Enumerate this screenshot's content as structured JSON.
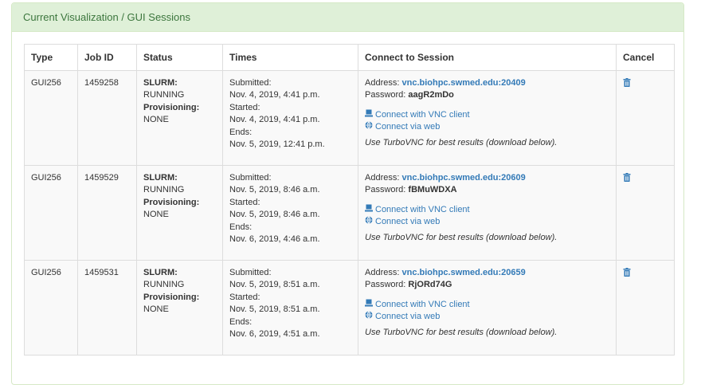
{
  "panel": {
    "title": "Current Visualization / GUI Sessions"
  },
  "table": {
    "headers": {
      "type": "Type",
      "job_id": "Job ID",
      "status": "Status",
      "times": "Times",
      "connect": "Connect to Session",
      "cancel": "Cancel"
    },
    "labels": {
      "slurm": "SLURM:",
      "provisioning": "Provisioning:",
      "submitted": "Submitted:",
      "started": "Started:",
      "ends": "Ends:",
      "address": "Address:",
      "password": "Password:",
      "connect_vnc": "Connect with VNC client",
      "connect_web": "Connect via web",
      "hint": "Use TurboVNC for best results (download below)."
    },
    "rows": [
      {
        "type": "GUI256",
        "job_id": "1459258",
        "slurm_status": "RUNNING",
        "provisioning_status": "NONE",
        "submitted": "Nov. 4, 2019, 4:41 p.m.",
        "started": "Nov. 4, 2019, 4:41 p.m.",
        "ends": "Nov. 5, 2019, 12:41 p.m.",
        "address": "vnc.biohpc.swmed.edu:20409",
        "password": "aagR2mDo"
      },
      {
        "type": "GUI256",
        "job_id": "1459529",
        "slurm_status": "RUNNING",
        "provisioning_status": "NONE",
        "submitted": "Nov. 5, 2019, 8:46 a.m.",
        "started": "Nov. 5, 2019, 8:46 a.m.",
        "ends": "Nov. 6, 2019, 4:46 a.m.",
        "address": "vnc.biohpc.swmed.edu:20609",
        "password": "fBMuWDXA"
      },
      {
        "type": "GUI256",
        "job_id": "1459531",
        "slurm_status": "RUNNING",
        "provisioning_status": "NONE",
        "submitted": "Nov. 5, 2019, 8:51 a.m.",
        "started": "Nov. 5, 2019, 8:51 a.m.",
        "ends": "Nov. 6, 2019, 4:51 a.m.",
        "address": "vnc.biohpc.swmed.edu:20659",
        "password": "RjORd74G"
      }
    ]
  },
  "icons": {
    "vnc": "laptop-icon",
    "web": "globe-icon",
    "cancel": "trash-icon"
  },
  "colors": {
    "heading_bg": "#dff0d8",
    "heading_text": "#3c763d",
    "link": "#337ab7",
    "row_bg": "#f9f9f9"
  }
}
